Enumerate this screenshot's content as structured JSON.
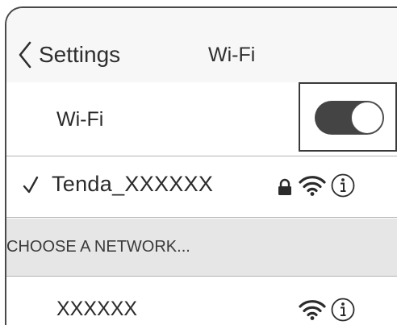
{
  "nav": {
    "back_label": "Settings",
    "title": "Wi-Fi"
  },
  "wifi_row": {
    "label": "Wi-Fi",
    "toggle_on": true
  },
  "connected_network": {
    "name": "Tenda_XXXXXX",
    "secured": true
  },
  "section_header": "CHOOSE A NETWORK...",
  "networks": [
    {
      "name": "XXXXXX"
    }
  ],
  "icons": {
    "back": "chevron-left-icon",
    "check": "checkmark-icon",
    "lock": "lock-icon",
    "wifi": "wifi-signal-icon",
    "info": "info-icon"
  },
  "colors": {
    "toggle_track": "#444444",
    "section_bg": "#e6e6e6",
    "nav_bg": "#f7f7f7"
  }
}
